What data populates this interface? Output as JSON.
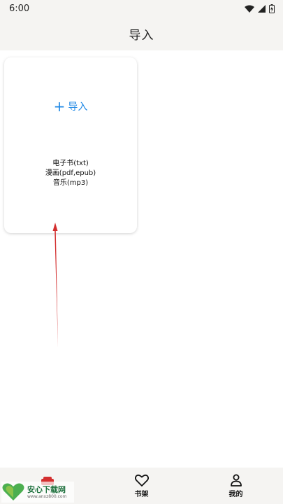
{
  "status_bar": {
    "time": "6:00"
  },
  "app_bar": {
    "title": "导入"
  },
  "import_card": {
    "import_label": "导入",
    "formats": [
      "电子书(txt)",
      "漫画(pdf,epub)",
      "音乐(mp3)"
    ]
  },
  "bottom_nav": {
    "items": [
      {
        "label": "",
        "icon": "bookshelf-icon"
      },
      {
        "label": "书架",
        "icon": "heart-icon"
      },
      {
        "label": "我的",
        "icon": "person-icon"
      }
    ]
  },
  "watermark": {
    "text": "安心下载网",
    "url": "www.anxz800.com"
  },
  "colors": {
    "accent": "#1e88e5",
    "bar_bg": "#f5f4f2",
    "arrow": "#d32f2f"
  }
}
